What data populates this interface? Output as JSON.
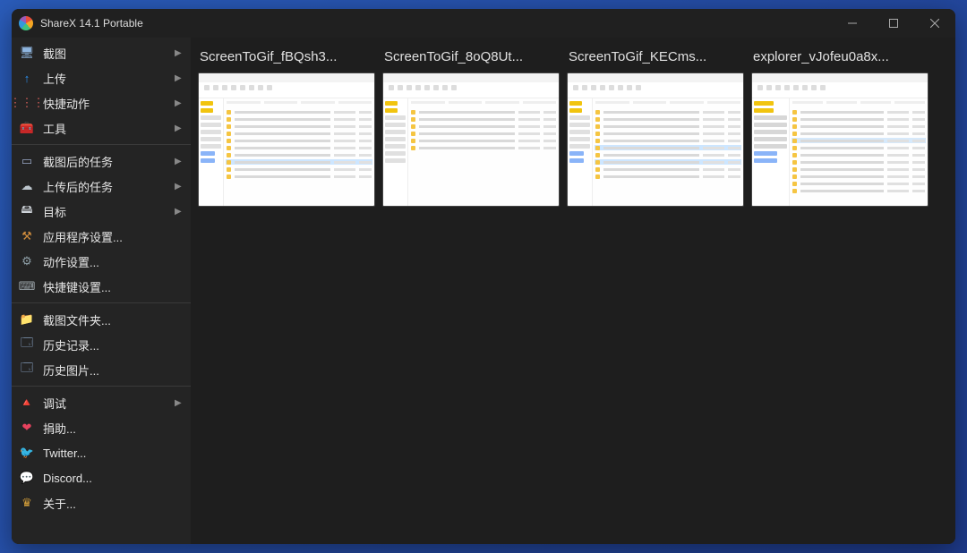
{
  "window": {
    "title": "ShareX 14.1 Portable"
  },
  "sidebar": {
    "groups": [
      {
        "items": [
          {
            "icon": "monitor-icon",
            "color": "#8fb6e0",
            "label": "截图",
            "arrow": true
          },
          {
            "icon": "upload-icon",
            "color": "#2b90ef",
            "label": "上传",
            "arrow": true
          },
          {
            "icon": "quick-icon",
            "color": "#d6605a",
            "label": "快捷动作",
            "arrow": true
          },
          {
            "icon": "toolbox-icon",
            "color": "#e84d3d",
            "label": "工具",
            "arrow": true
          }
        ]
      },
      {
        "items": [
          {
            "icon": "tasks-icon",
            "color": "#9aa8c6",
            "label": "截图后的任务",
            "arrow": true
          },
          {
            "icon": "cloud-icon",
            "color": "#bcc5cc",
            "label": "上传后的任务",
            "arrow": true
          },
          {
            "icon": "target-icon",
            "color": "#cfd4da",
            "label": "目标",
            "arrow": true
          },
          {
            "icon": "wrench-icon",
            "color": "#d08d3d",
            "label": "应用程序设置...",
            "arrow": false
          },
          {
            "icon": "gear-icon",
            "color": "#8fa0a8",
            "label": "动作设置...",
            "arrow": false
          },
          {
            "icon": "keyboard-icon",
            "color": "#9aa3a8",
            "label": "快捷键设置...",
            "arrow": false
          }
        ]
      },
      {
        "items": [
          {
            "icon": "folder-icon",
            "color": "#e8a23a",
            "label": "截图文件夹...",
            "arrow": false
          },
          {
            "icon": "history-icon",
            "color": "#93b0d4",
            "label": "历史记录...",
            "arrow": false
          },
          {
            "icon": "gallery-icon",
            "color": "#93b0d4",
            "label": "历史图片...",
            "arrow": false
          }
        ]
      },
      {
        "items": [
          {
            "icon": "cone-icon",
            "color": "#e8a23a",
            "label": "调试",
            "arrow": true
          },
          {
            "icon": "heart-icon",
            "color": "#e8425e",
            "label": "捐助...",
            "arrow": false
          },
          {
            "icon": "twitter-icon",
            "color": "#1da1f2",
            "label": "Twitter...",
            "arrow": false
          },
          {
            "icon": "discord-icon",
            "color": "#5865f2",
            "label": "Discord...",
            "arrow": false
          },
          {
            "icon": "crown-icon",
            "color": "#d6a03a",
            "label": "关于...",
            "arrow": false
          }
        ]
      }
    ]
  },
  "thumbnails": {
    "items": [
      {
        "label": "ScreenToGif_fBQsh3..."
      },
      {
        "label": "ScreenToGif_8oQ8Ut..."
      },
      {
        "label": "ScreenToGif_KECms..."
      },
      {
        "label": "explorer_vJofeu0a8x..."
      }
    ]
  },
  "icon_glyphs": {
    "monitor-icon": "🖥",
    "upload-icon": "↑",
    "quick-icon": "⋮⋮⋮",
    "toolbox-icon": "🧰",
    "tasks-icon": "▭",
    "cloud-icon": "☁",
    "target-icon": "🖴",
    "wrench-icon": "⚒",
    "gear-icon": "⚙",
    "keyboard-icon": "⌨",
    "folder-icon": "📁",
    "history-icon": "🗔",
    "gallery-icon": "🗔",
    "cone-icon": "🔺",
    "heart-icon": "❤",
    "twitter-icon": "🐦",
    "discord-icon": "💬",
    "crown-icon": "♛"
  }
}
